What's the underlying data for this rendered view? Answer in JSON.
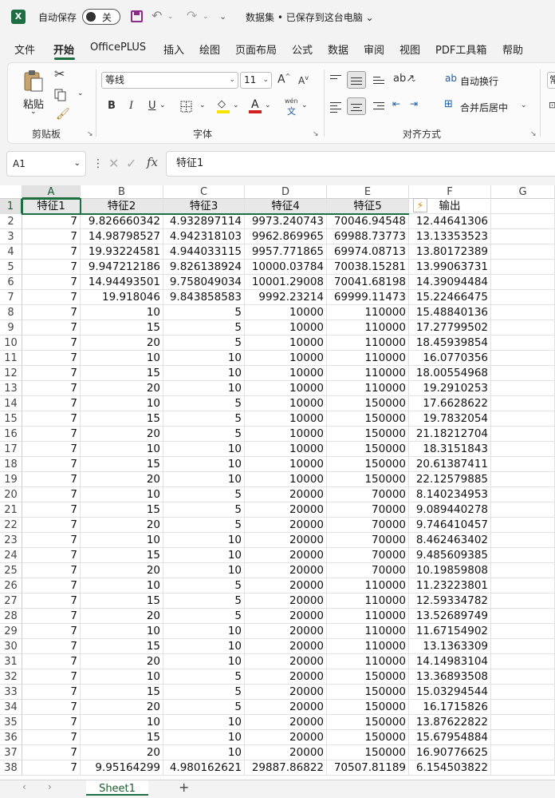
{
  "titlebar": {
    "autosave_label": "自动保存",
    "autosave_state": "关",
    "doc_title": "数据集 • 已保存到这台电脑 ⌄"
  },
  "tabs": [
    "文件",
    "开始",
    "OfficePLUS",
    "插入",
    "绘图",
    "页面布局",
    "公式",
    "数据",
    "审阅",
    "视图",
    "PDF工具箱",
    "帮助"
  ],
  "active_tab": "开始",
  "ribbon": {
    "paste_label": "粘贴",
    "clipboard_group": "剪贴板",
    "font_name": "等线",
    "font_size": "11",
    "font_group": "字体",
    "bold": "B",
    "italic": "I",
    "underline": "U",
    "wen_label": "wén",
    "wrap_text": "自动换行",
    "merge_center": "合并后居中",
    "alignment_group": "对齐方式",
    "cut_partial": "常"
  },
  "formula_bar": {
    "cell_ref": "A1",
    "fx": "fx",
    "content": "特征1"
  },
  "columns": [
    "A",
    "B",
    "C",
    "D",
    "E",
    "F",
    "G"
  ],
  "headers": [
    "特征1",
    "特征2",
    "特征3",
    "特征4",
    "特征5",
    "输出"
  ],
  "rows": [
    [
      "7",
      "9.826660342",
      "4.932897114",
      "9973.240743",
      "70046.94548",
      "12.44641306"
    ],
    [
      "7",
      "14.98798527",
      "4.942318103",
      "9962.869965",
      "69988.73773",
      "13.13353523"
    ],
    [
      "7",
      "19.93224581",
      "4.944033115",
      "9957.771865",
      "69974.08713",
      "13.80172389"
    ],
    [
      "7",
      "9.947212186",
      "9.826138924",
      "10000.03784",
      "70038.15281",
      "13.99063731"
    ],
    [
      "7",
      "14.94493501",
      "9.758049034",
      "10001.29008",
      "70041.68198",
      "14.39094484"
    ],
    [
      "7",
      "19.918046",
      "9.843858583",
      "9992.23214",
      "69999.11473",
      "15.22466475"
    ],
    [
      "7",
      "10",
      "5",
      "10000",
      "110000",
      "15.48840136"
    ],
    [
      "7",
      "15",
      "5",
      "10000",
      "110000",
      "17.27799502"
    ],
    [
      "7",
      "20",
      "5",
      "10000",
      "110000",
      "18.45939854"
    ],
    [
      "7",
      "10",
      "10",
      "10000",
      "110000",
      "16.0770356"
    ],
    [
      "7",
      "15",
      "10",
      "10000",
      "110000",
      "18.00554968"
    ],
    [
      "7",
      "20",
      "10",
      "10000",
      "110000",
      "19.2910253"
    ],
    [
      "7",
      "10",
      "5",
      "10000",
      "150000",
      "17.6628622"
    ],
    [
      "7",
      "15",
      "5",
      "10000",
      "150000",
      "19.7832054"
    ],
    [
      "7",
      "20",
      "5",
      "10000",
      "150000",
      "21.18212704"
    ],
    [
      "7",
      "10",
      "10",
      "10000",
      "150000",
      "18.3151843"
    ],
    [
      "7",
      "15",
      "10",
      "10000",
      "150000",
      "20.61387411"
    ],
    [
      "7",
      "20",
      "10",
      "10000",
      "150000",
      "22.12579885"
    ],
    [
      "7",
      "10",
      "5",
      "20000",
      "70000",
      "8.140234953"
    ],
    [
      "7",
      "15",
      "5",
      "20000",
      "70000",
      "9.089440278"
    ],
    [
      "7",
      "20",
      "5",
      "20000",
      "70000",
      "9.746410457"
    ],
    [
      "7",
      "10",
      "10",
      "20000",
      "70000",
      "8.462463402"
    ],
    [
      "7",
      "15",
      "10",
      "20000",
      "70000",
      "9.485609385"
    ],
    [
      "7",
      "20",
      "10",
      "20000",
      "70000",
      "10.19859808"
    ],
    [
      "7",
      "10",
      "5",
      "20000",
      "110000",
      "11.23223801"
    ],
    [
      "7",
      "15",
      "5",
      "20000",
      "110000",
      "12.59334782"
    ],
    [
      "7",
      "20",
      "5",
      "20000",
      "110000",
      "13.52689749"
    ],
    [
      "7",
      "10",
      "10",
      "20000",
      "110000",
      "11.67154902"
    ],
    [
      "7",
      "15",
      "10",
      "20000",
      "110000",
      "13.1363309"
    ],
    [
      "7",
      "20",
      "10",
      "20000",
      "110000",
      "14.14983104"
    ],
    [
      "7",
      "10",
      "5",
      "20000",
      "150000",
      "13.36893508"
    ],
    [
      "7",
      "15",
      "5",
      "20000",
      "150000",
      "15.03294544"
    ],
    [
      "7",
      "20",
      "5",
      "20000",
      "150000",
      "16.1715826"
    ],
    [
      "7",
      "10",
      "10",
      "20000",
      "150000",
      "13.87622822"
    ],
    [
      "7",
      "15",
      "10",
      "20000",
      "150000",
      "15.67954884"
    ],
    [
      "7",
      "20",
      "10",
      "20000",
      "150000",
      "16.90776625"
    ],
    [
      "7",
      "9.95164299",
      "4.980162621",
      "29887.86822",
      "70507.81189",
      "6.154503822"
    ]
  ],
  "sheet_tab": "Sheet1",
  "colors": {
    "accent": "#1d6f42",
    "header_fill": "#e8e8e8"
  }
}
